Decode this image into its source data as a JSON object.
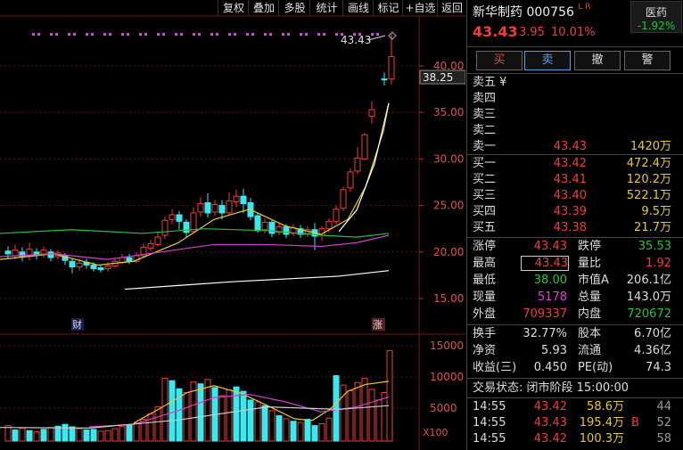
{
  "toolbar": {
    "buttons": [
      "复权",
      "叠加",
      "多股",
      "统计",
      "画线",
      "标记",
      "+自选",
      "返回"
    ]
  },
  "chart": {
    "price_ticks": [
      "40.00",
      "35.00",
      "30.00",
      "25.00",
      "20.00",
      "15.00"
    ],
    "vol_ticks": [
      "15000",
      "10000",
      "5000"
    ],
    "vol_unit": "X100",
    "high_label": "43.43",
    "price_tag": "38.25",
    "marker_cai": "财",
    "marker_zhang": "涨",
    "colors": {
      "up": "#f03c3c",
      "down": "#3ce8f0",
      "ma5": "#ffffff",
      "ma10": "#e8c832",
      "ma20": "#d040d0",
      "ma30": "#22c43c"
    }
  },
  "header": {
    "name": "新华制药",
    "code": "000756",
    "tag": "L R",
    "sector": "医药",
    "sector_change": "-1.92%",
    "price": "43.43",
    "change": "3.95",
    "change_pct": "10.01%"
  },
  "actions": [
    "买",
    "卖",
    "撤",
    "警"
  ],
  "sell_label_head": "卖五 ¥",
  "sells": [
    {
      "label": "卖四",
      "price": "",
      "vol": ""
    },
    {
      "label": "卖三",
      "price": "",
      "vol": ""
    },
    {
      "label": "卖二",
      "price": "",
      "vol": ""
    },
    {
      "label": "卖一",
      "price": "43.43",
      "vol": "1420万"
    }
  ],
  "buys": [
    {
      "label": "买一",
      "price": "43.42",
      "vol": "472.4万"
    },
    {
      "label": "买二",
      "price": "43.41",
      "vol": "120.2万"
    },
    {
      "label": "买三",
      "price": "43.40",
      "vol": "522.1万"
    },
    {
      "label": "买四",
      "price": "43.39",
      "vol": "9.5万"
    },
    {
      "label": "买五",
      "price": "43.38",
      "vol": "21.7万"
    }
  ],
  "stats1": [
    {
      "l1": "涨停",
      "v1": "43.43",
      "c1": "red",
      "l2": "跌停",
      "v2": "35.53",
      "c2": "green"
    },
    {
      "l1": "最高",
      "v1": "43.43",
      "c1": "red",
      "l2": "量比",
      "v2": "1.92",
      "c2": "red"
    },
    {
      "l1": "最低",
      "v1": "38.00",
      "c1": "green",
      "l2": "市值A",
      "v2": "206.1亿",
      "c2": "white"
    },
    {
      "l1": "现量",
      "v1": "5178",
      "c1": "magenta",
      "l2": "总量",
      "v2": "143.0万",
      "c2": "white"
    },
    {
      "l1": "外盘",
      "v1": "709337",
      "c1": "red",
      "l2": "内盘",
      "v2": "720672",
      "c2": "green"
    }
  ],
  "stats2": [
    {
      "l1": "换手",
      "v1": "32.77%",
      "l2": "股本",
      "v2": "6.70亿"
    },
    {
      "l1": "净资",
      "v1": "5.93",
      "l2": "流通",
      "v2": "4.36亿"
    },
    {
      "l1": "收益(三)",
      "v1": "0.450",
      "l2": "PE(动)",
      "v2": "74.3"
    }
  ],
  "trade_status": "交易状态: 闭市阶段 15:00:00",
  "ticks": [
    {
      "time": "14:55",
      "price": "43.42",
      "vol": "58.6万",
      "flag": "",
      "n": "44"
    },
    {
      "time": "14:55",
      "price": "43.43",
      "vol": "195.4万",
      "flag": "B",
      "n": "52"
    },
    {
      "time": "14:55",
      "price": "43.42",
      "vol": "100.3万",
      "flag": "",
      "n": "58"
    }
  ]
}
